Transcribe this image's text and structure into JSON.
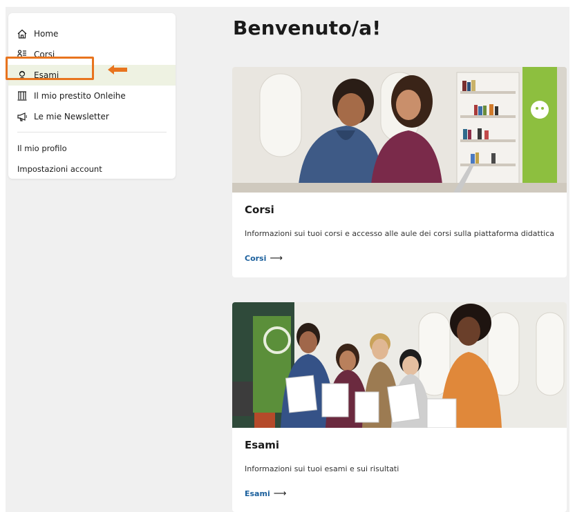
{
  "sidebar": {
    "items": [
      {
        "label": "Home",
        "icon": "home-icon"
      },
      {
        "label": "Corsi",
        "icon": "courses-icon"
      },
      {
        "label": "Esami",
        "icon": "exam-icon"
      },
      {
        "label": "Il mio prestito Onleihe",
        "icon": "library-icon"
      },
      {
        "label": "Le mie Newsletter",
        "icon": "megaphone-icon"
      }
    ],
    "active_item": "Esami",
    "profile_link": "Il mio profilo",
    "account_link": "Impostazioni account"
  },
  "main": {
    "title": "Benvenuto/a!",
    "cards": [
      {
        "title": "Corsi",
        "description": "Informazioni sui tuoi corsi e accesso alle aule dei corsi sulla piattaforma didattica",
        "link": "Corsi",
        "arrow": "⟶"
      },
      {
        "title": "Esami",
        "description": "Informazioni sui tuoi esami e sui risultati",
        "link": "Esami",
        "arrow": "⟶"
      }
    ]
  },
  "colors": {
    "highlight": "#e8741e",
    "active_bg": "#eef2e2",
    "link": "#1a5f9c",
    "page_bg": "#f0f0f0",
    "brand_green": "#8bc34a"
  }
}
